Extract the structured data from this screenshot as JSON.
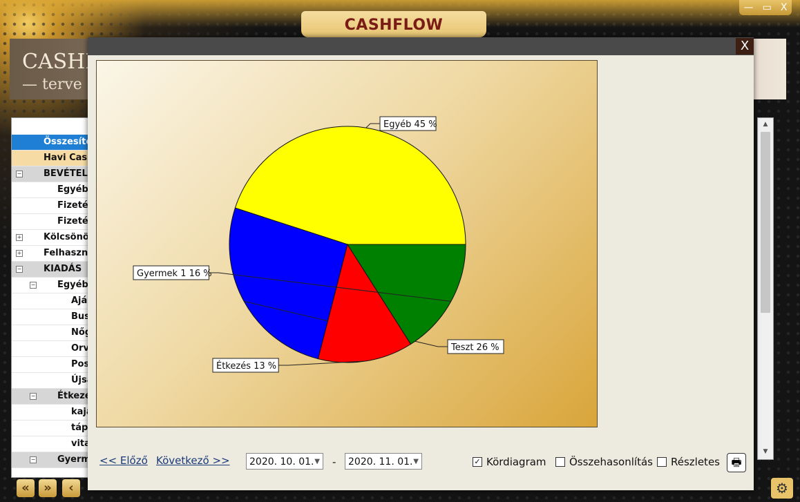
{
  "window": {
    "title": "CASHFLOW",
    "controls": [
      "—",
      "▭",
      "X"
    ]
  },
  "background": {
    "logo": "CASHF",
    "logo_sub": "— terve",
    "tree": [
      {
        "label": "Összesítet",
        "state": "sel",
        "indent": 0
      },
      {
        "label": "Havi Cash",
        "state": "hl",
        "indent": 0
      },
      {
        "label": "BEVÉTEL",
        "state": "grp",
        "indent": 0,
        "expander": "−"
      },
      {
        "label": "Egyéb",
        "state": "",
        "indent": 1
      },
      {
        "label": "Fizetés",
        "state": "",
        "indent": 1
      },
      {
        "label": "Fizetés",
        "state": "",
        "indent": 1
      },
      {
        "label": "Kölcsönöl",
        "state": "",
        "indent": 0,
        "expander": "+"
      },
      {
        "label": "Felhaszná",
        "state": "",
        "indent": 0,
        "expander": "+"
      },
      {
        "label": "KIADÁS",
        "state": "grp",
        "indent": 0,
        "expander": "−"
      },
      {
        "label": "Egyéb",
        "state": "",
        "indent": 1,
        "expander": "−"
      },
      {
        "label": "Aján",
        "state": "",
        "indent": 2
      },
      {
        "label": "Bus.",
        "state": "",
        "indent": 2
      },
      {
        "label": "Nőg",
        "state": "",
        "indent": 2
      },
      {
        "label": "Orv",
        "state": "",
        "indent": 2
      },
      {
        "label": "Post",
        "state": "",
        "indent": 2
      },
      {
        "label": "Újsa",
        "state": "",
        "indent": 2
      },
      {
        "label": "Étkezé",
        "state": "grp",
        "indent": 1,
        "expander": "−"
      },
      {
        "label": "kaja",
        "state": "",
        "indent": 2
      },
      {
        "label": "tápl",
        "state": "",
        "indent": 2
      },
      {
        "label": "vita",
        "state": "",
        "indent": 2
      },
      {
        "label": "Gyerm",
        "state": "grp",
        "indent": 1,
        "expander": "−"
      }
    ]
  },
  "modal": {
    "close_label": "X",
    "nav": {
      "prev_label": "<< Előző",
      "next_label": "Következő >>"
    },
    "date_from": "2020. 10. 01.",
    "date_to": "2020. 11. 01.",
    "date_separator": "-",
    "options": [
      {
        "label": "Kördiagram",
        "checked": true
      },
      {
        "label": "Összehasonlítás",
        "checked": false
      },
      {
        "label": "Részletes",
        "checked": false
      }
    ],
    "print_icon": "printer-icon"
  },
  "chart_data": {
    "type": "pie",
    "slices": [
      {
        "name": "Egyéb",
        "value": 45,
        "label": "Egyéb 45 %",
        "color": "#ffff00"
      },
      {
        "name": "Teszt",
        "value": 26,
        "label": "Teszt 26 %",
        "color": "#0000ff"
      },
      {
        "name": "Étkezés",
        "value": 13,
        "label": "Étkezés 13 %",
        "color": "#ff0000"
      },
      {
        "name": "Gyermek 1",
        "value": 16,
        "label": "Gyermek 1 16 %",
        "color": "#008000"
      }
    ]
  }
}
